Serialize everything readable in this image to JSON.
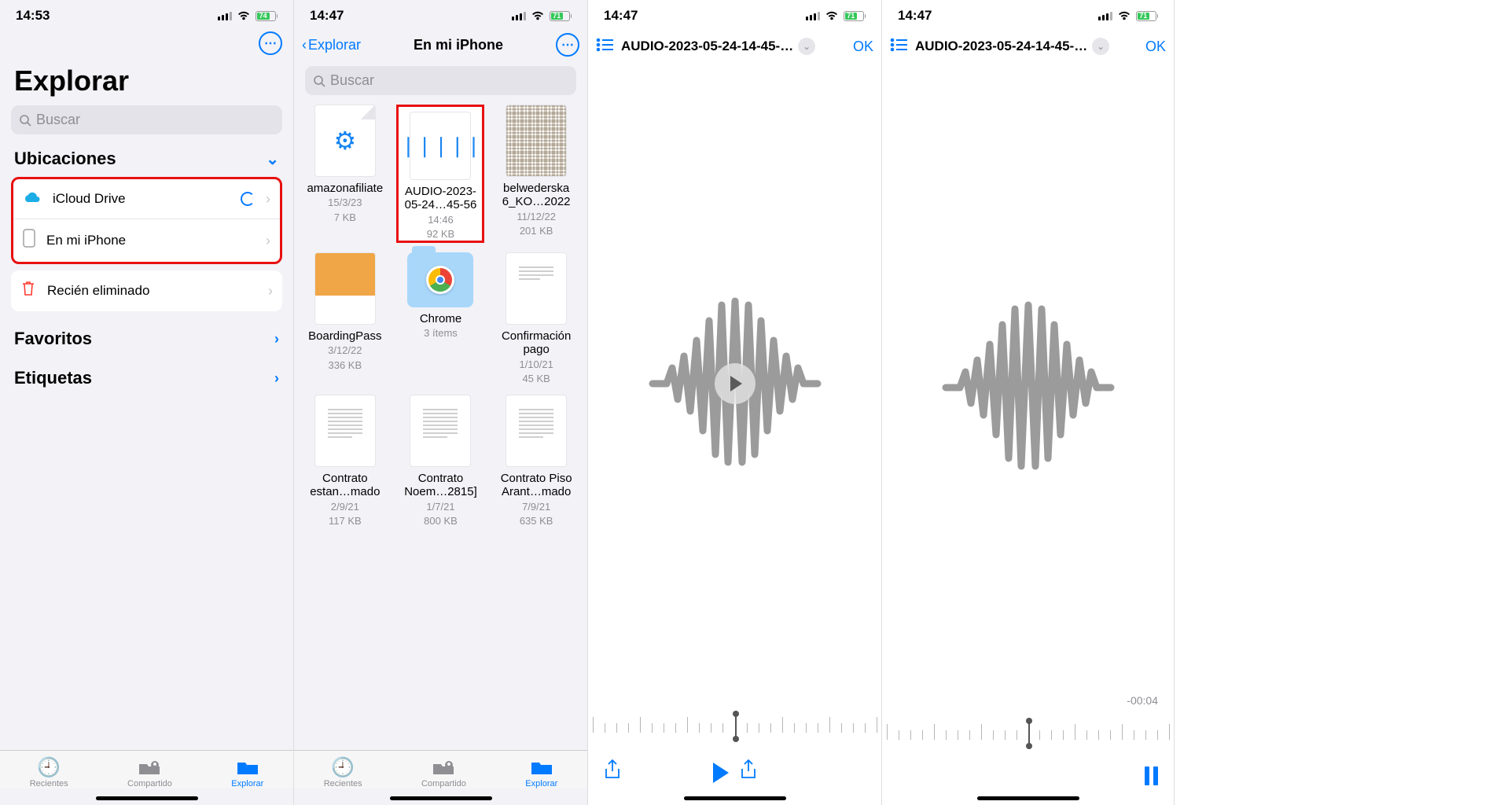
{
  "screen1": {
    "time": "14:53",
    "battery": "74",
    "title": "Explorar",
    "search_placeholder": "Buscar",
    "ubicaciones_label": "Ubicaciones",
    "icloud_label": "iCloud Drive",
    "en_mi_iphone": "En mi iPhone",
    "recien_eliminado": "Recién eliminado",
    "favoritos_label": "Favoritos",
    "etiquetas_label": "Etiquetas",
    "tabs": {
      "recientes": "Recientes",
      "compartido": "Compartido",
      "explorar": "Explorar"
    }
  },
  "screen2": {
    "time": "14:47",
    "battery": "71",
    "back_label": "Explorar",
    "title": "En mi iPhone",
    "search_placeholder": "Buscar",
    "items": [
      {
        "name": "amazonafiliate",
        "date": "15/3/23",
        "size": "7 KB",
        "kind": "gear"
      },
      {
        "name": "AUDIO-2023-05-24…45-56",
        "date": "14:46",
        "size": "92 KB",
        "kind": "audio",
        "highlighted": true
      },
      {
        "name": "belwederska 6_KO…2022",
        "date": "11/12/22",
        "size": "201 KB",
        "kind": "plan"
      },
      {
        "name": "BoardingPass",
        "date": "3/12/22",
        "size": "336 KB",
        "kind": "bp"
      },
      {
        "name": "Chrome",
        "date": "3 ítems",
        "size": "",
        "kind": "chrome-folder"
      },
      {
        "name": "Confirmación pago",
        "date": "1/10/21",
        "size": "45 KB",
        "kind": "lines"
      },
      {
        "name": "Contrato estan…mado",
        "date": "2/9/21",
        "size": "117 KB",
        "kind": "doc"
      },
      {
        "name": "Contrato Noem…2815]",
        "date": "1/7/21",
        "size": "800 KB",
        "kind": "doc"
      },
      {
        "name": "Contrato Piso Arant…mado",
        "date": "7/9/21",
        "size": "635 KB",
        "kind": "doc"
      }
    ],
    "tabs": {
      "recientes": "Recientes",
      "compartido": "Compartido",
      "explorar": "Explorar"
    }
  },
  "screen3": {
    "time": "14:47",
    "battery": "71",
    "title": "AUDIO-2023-05-24-14-45-…",
    "ok": "OK",
    "playing": false
  },
  "screen4": {
    "time": "14:47",
    "battery": "71",
    "title": "AUDIO-2023-05-24-14-45-…",
    "ok": "OK",
    "time_remaining": "-00:04",
    "playing": true
  }
}
